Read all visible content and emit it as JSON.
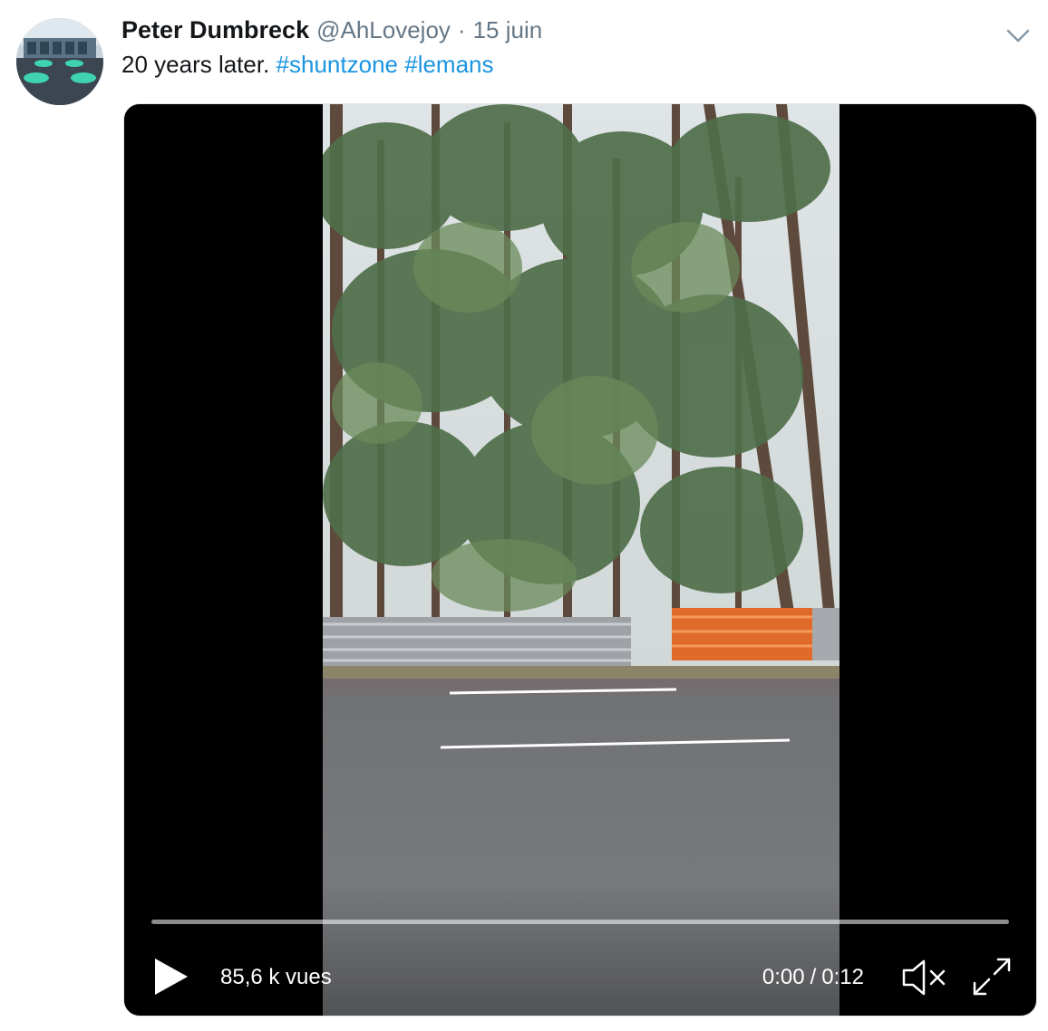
{
  "tweet": {
    "author_name": "Peter Dumbreck",
    "handle": "@AhLovejoy",
    "separator": "·",
    "date": "15 juin",
    "text_plain": "20 years later.",
    "hashtags": [
      "#shuntzone",
      "#lemans"
    ]
  },
  "icons": {
    "menu": "chevron-down-icon",
    "play": "play-icon",
    "mute": "volume-muted-icon",
    "fullscreen": "expand-icon"
  },
  "video": {
    "views": "85,6 k vues",
    "current_time": "0:00",
    "time_separator": "/",
    "duration": "0:12",
    "progress": 0
  },
  "colors": {
    "link": "#1b95e0",
    "name": "#14171a",
    "secondary": "#657786",
    "video_background": "#000000"
  }
}
